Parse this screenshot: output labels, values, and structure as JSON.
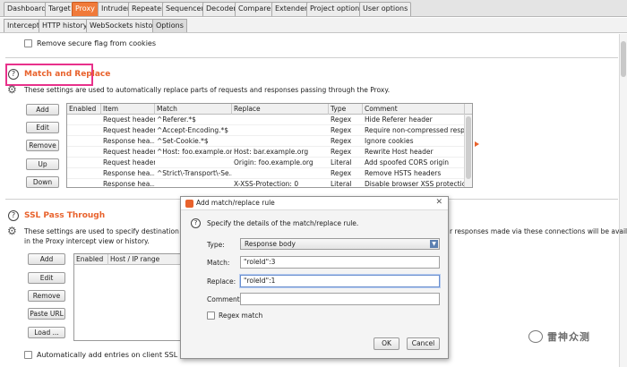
{
  "top_tabs": [
    "Dashboard",
    "Target",
    "Proxy",
    "Intruder",
    "Repeater",
    "Sequencer",
    "Decoder",
    "Comparer",
    "Extender",
    "Project options",
    "User options"
  ],
  "active_top_tab": "Proxy",
  "sub_tabs": [
    "Intercept",
    "HTTP history",
    "WebSockets history",
    "Options"
  ],
  "active_sub_tab": "Options",
  "remove_secure_flag_label": "Remove secure flag from cookies",
  "match_replace": {
    "title": "Match and Replace",
    "description": "These settings are used to automatically replace parts of requests and responses passing through the Proxy.",
    "buttons": [
      "Add",
      "Edit",
      "Remove",
      "Up",
      "Down"
    ],
    "columns": [
      "Enabled",
      "Item",
      "Match",
      "Replace",
      "Type",
      "Comment"
    ],
    "rows": [
      {
        "item": "Request header",
        "match": "^Referer.*$",
        "replace": "",
        "type": "Regex",
        "comment": "Hide Referer header"
      },
      {
        "item": "Request header",
        "match": "^Accept-Encoding.*$",
        "replace": "",
        "type": "Regex",
        "comment": "Require non-compressed respo..."
      },
      {
        "item": "Response hea...",
        "match": "^Set-Cookie.*$",
        "replace": "",
        "type": "Regex",
        "comment": "Ignore cookies"
      },
      {
        "item": "Request header",
        "match": "^Host: foo.example.org$",
        "replace": "Host: bar.example.org",
        "type": "Regex",
        "comment": "Rewrite Host header"
      },
      {
        "item": "Request header",
        "match": "",
        "replace": "Origin: foo.example.org",
        "type": "Literal",
        "comment": "Add spoofed CORS origin"
      },
      {
        "item": "Response hea...",
        "match": "^Strict\\-Transport\\-Se...",
        "replace": "",
        "type": "Regex",
        "comment": "Remove HSTS headers"
      },
      {
        "item": "Response hea...",
        "match": "",
        "replace": "X-XSS-Protection: 0",
        "type": "Literal",
        "comment": "Disable browser XSS protection"
      }
    ]
  },
  "ssl_pass": {
    "title": "SSL Pass Through",
    "description_line1": "These settings are used to specify destination web se",
    "description_line1_right": "r responses made via these connections will be available",
    "description_line2": "in the Proxy intercept view or history.",
    "buttons": [
      "Add",
      "Edit",
      "Remove",
      "Paste URL",
      "Load ..."
    ],
    "columns": [
      "Enabled",
      "Host / IP range"
    ],
    "auto_add_label": "Automatically add entries on client SSL negotiatio"
  },
  "dialog": {
    "title": "Add match/replace rule",
    "instruction": "Specify the details of the match/replace rule.",
    "type_label": "Type:",
    "type_value": "Response body",
    "match_label": "Match:",
    "match_value": "\"roleId\":3",
    "replace_label": "Replace:",
    "replace_value": "\"roleId\":1",
    "comment_label": "Comment:",
    "comment_value": "",
    "regex_label": "Regex match",
    "ok_label": "OK",
    "cancel_label": "Cancel",
    "close_glyph": "✕"
  },
  "watermark_text": "雷神众测",
  "accent_color": "#e8622c",
  "highlight_color": "#e8318b"
}
